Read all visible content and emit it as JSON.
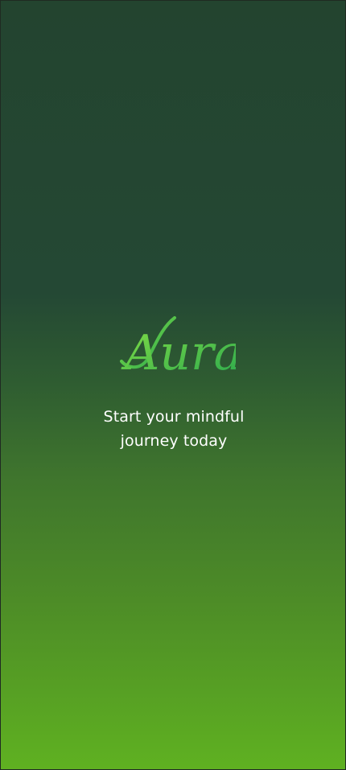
{
  "app": {
    "logo_text": "Aura",
    "tagline_line1": "Start your mindful",
    "tagline_line2": "journey today"
  },
  "colors": {
    "background_top": "#23442f",
    "background_bottom": "#5fb121",
    "logo_light": "#7cd63f",
    "logo_dark": "#2fae4d",
    "text": "#ffffff"
  }
}
